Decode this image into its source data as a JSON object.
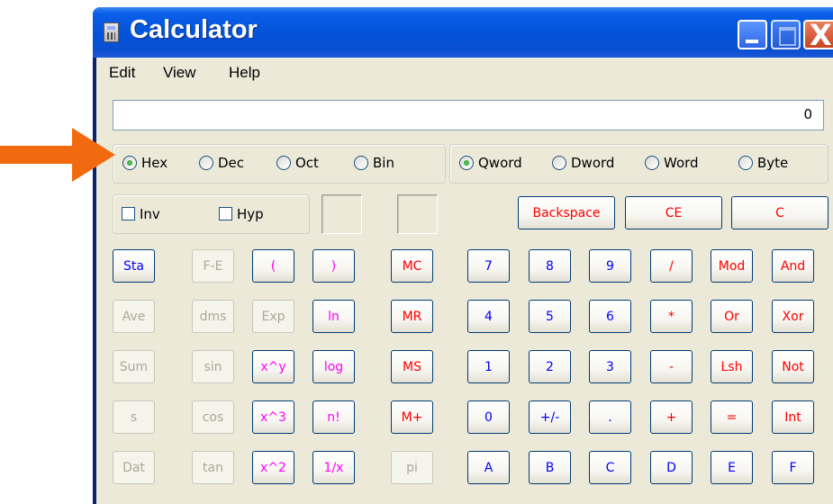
{
  "window": {
    "title": "Calculator"
  },
  "titlebar_buttons": {
    "close_glyph": "X"
  },
  "menu": [
    "Edit",
    "View",
    "Help"
  ],
  "display": {
    "value": "0"
  },
  "number_system": {
    "options": [
      "Hex",
      "Dec",
      "Oct",
      "Bin"
    ],
    "selected": "Hex"
  },
  "word_size": {
    "options": [
      "Qword",
      "Dword",
      "Word",
      "Byte"
    ],
    "selected": "Qword"
  },
  "checkboxes": [
    "Inv",
    "Hyp"
  ],
  "clear_buttons": [
    "Backspace",
    "CE",
    "C"
  ],
  "left_grid": [
    [
      "Sta",
      "F-E",
      "(",
      ")"
    ],
    [
      "Ave",
      "dms",
      "Exp",
      "ln"
    ],
    [
      "Sum",
      "sin",
      "x^y",
      "log"
    ],
    [
      "s",
      "cos",
      "x^3",
      "n!"
    ],
    [
      "Dat",
      "tan",
      "x^2",
      "1/x"
    ]
  ],
  "memory_buttons": [
    "MC",
    "MR",
    "MS",
    "M+",
    "pi"
  ],
  "right_grid": [
    [
      "7",
      "8",
      "9",
      "/",
      "Mod",
      "And"
    ],
    [
      "4",
      "5",
      "6",
      "*",
      "Or",
      "Xor"
    ],
    [
      "1",
      "2",
      "3",
      "-",
      "Lsh",
      "Not"
    ],
    [
      "0",
      "+/-",
      ".",
      "+",
      "=",
      "Int"
    ],
    [
      "A",
      "B",
      "C",
      "D",
      "E",
      "F"
    ]
  ],
  "colors": {
    "arrow": "#f26a10",
    "titlebar": "#0353d8",
    "blue_text": "#0000ff",
    "red_text": "#ff0000",
    "magenta_text": "#ff00ff",
    "disabled_text": "#aca899"
  }
}
